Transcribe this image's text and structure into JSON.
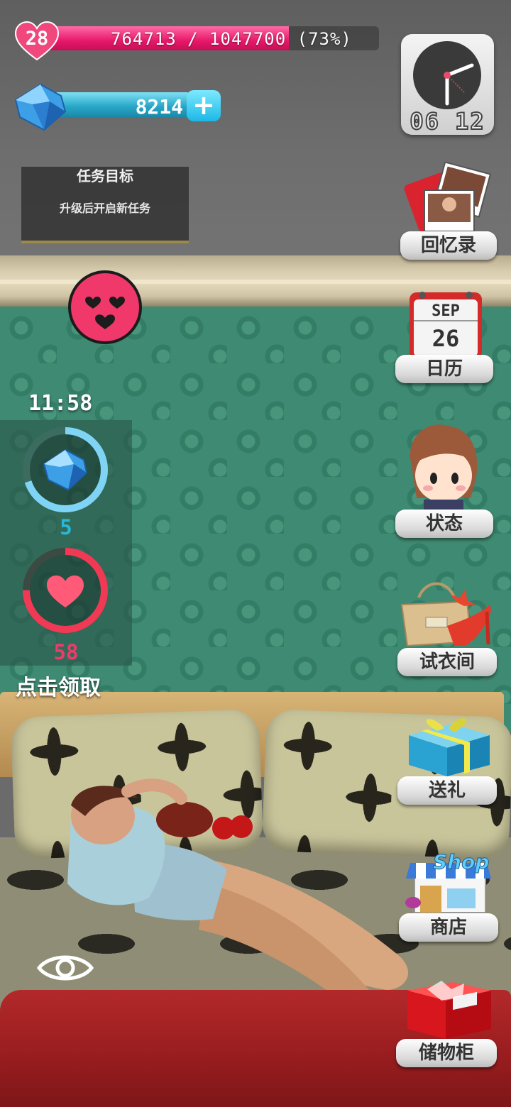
{
  "player": {
    "level": "28",
    "hp_text": "764713 / 1047700 (73%)",
    "hp_fraction": 0.73
  },
  "currency": {
    "gems": "8214",
    "add_label": "+"
  },
  "quest": {
    "title": "任务目标",
    "description": "升级后开启新任务"
  },
  "clock": {
    "time": "06 12"
  },
  "timer": {
    "countdown": "11:58"
  },
  "rewards": {
    "gem_count": "5",
    "gem_progress": 0.7,
    "heart_count": "58",
    "heart_progress": 0.75,
    "claim_label": "点击领取"
  },
  "menu": {
    "memories": "回忆录",
    "calendar": "日历",
    "calendar_month": "SEP",
    "calendar_day": "26",
    "status": "状态",
    "dressing_room": "试衣间",
    "gift": "送礼",
    "shop": "商店",
    "shop_sign": "Shop",
    "storage": "储物柜"
  },
  "colors": {
    "hp_fill": "#e8186a",
    "gem_bar": "#29a8c8",
    "gem_ring": "#7fd4f5",
    "heart_ring": "#f03a55",
    "gem_count": "#2ab7d6",
    "heart_count": "#f03a6a"
  },
  "icons": {
    "level": "heart-icon",
    "currency": "diamond-icon",
    "mood": "love-face-icon",
    "view": "eye-icon"
  }
}
